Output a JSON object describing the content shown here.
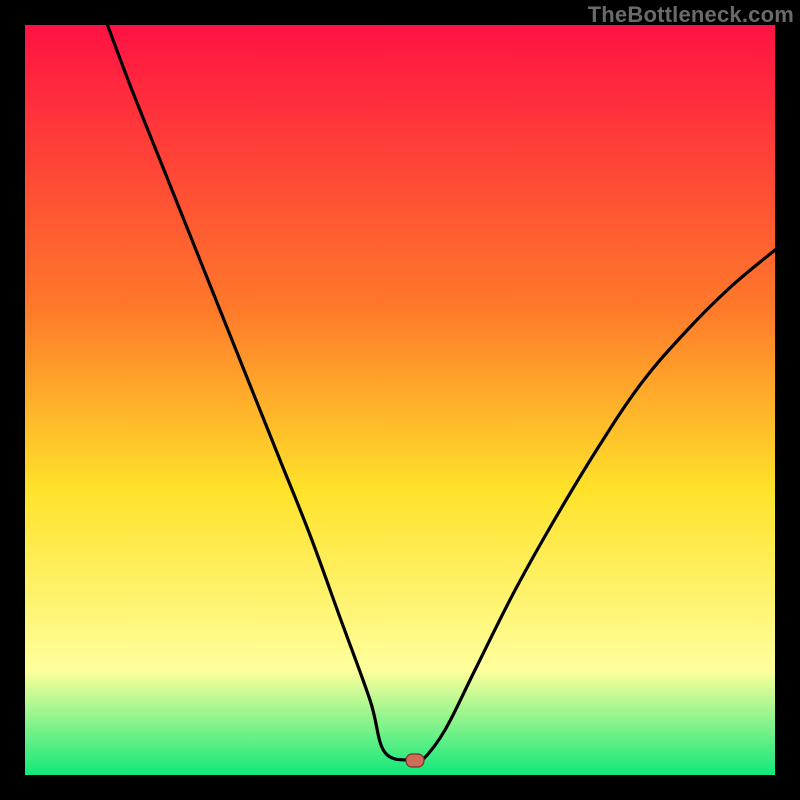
{
  "watermark": "TheBottleneck.com",
  "chart_data": {
    "type": "line",
    "title": "",
    "xlabel": "",
    "ylabel": "",
    "xlim": [
      0,
      100
    ],
    "ylim": [
      0,
      100
    ],
    "gradient_colors": {
      "top": "#ff1243",
      "upper_mid": "#ff7a2a",
      "mid": "#ffe22a",
      "lower_mid": "#ffff9c",
      "bottom": "#10e87a"
    },
    "curve_stroke": "#000000",
    "minimum_x": 52,
    "minimum_y": 2,
    "minimum_plateau_x": [
      48,
      53
    ],
    "marker": {
      "x": 52,
      "y": 2,
      "fill": "#cf6b59",
      "stroke": "#7a3228"
    },
    "series": [
      {
        "name": "bottleneck-curve",
        "points": [
          {
            "x": 11,
            "y": 100
          },
          {
            "x": 14,
            "y": 92
          },
          {
            "x": 18,
            "y": 82
          },
          {
            "x": 22,
            "y": 72
          },
          {
            "x": 26,
            "y": 62
          },
          {
            "x": 30,
            "y": 52
          },
          {
            "x": 34,
            "y": 42
          },
          {
            "x": 38,
            "y": 32
          },
          {
            "x": 42,
            "y": 21
          },
          {
            "x": 46,
            "y": 10
          },
          {
            "x": 48,
            "y": 3
          },
          {
            "x": 52,
            "y": 2
          },
          {
            "x": 53,
            "y": 2
          },
          {
            "x": 56,
            "y": 6
          },
          {
            "x": 60,
            "y": 14
          },
          {
            "x": 65,
            "y": 24
          },
          {
            "x": 70,
            "y": 33
          },
          {
            "x": 76,
            "y": 43
          },
          {
            "x": 82,
            "y": 52
          },
          {
            "x": 88,
            "y": 59
          },
          {
            "x": 94,
            "y": 65
          },
          {
            "x": 100,
            "y": 70
          }
        ]
      }
    ]
  }
}
